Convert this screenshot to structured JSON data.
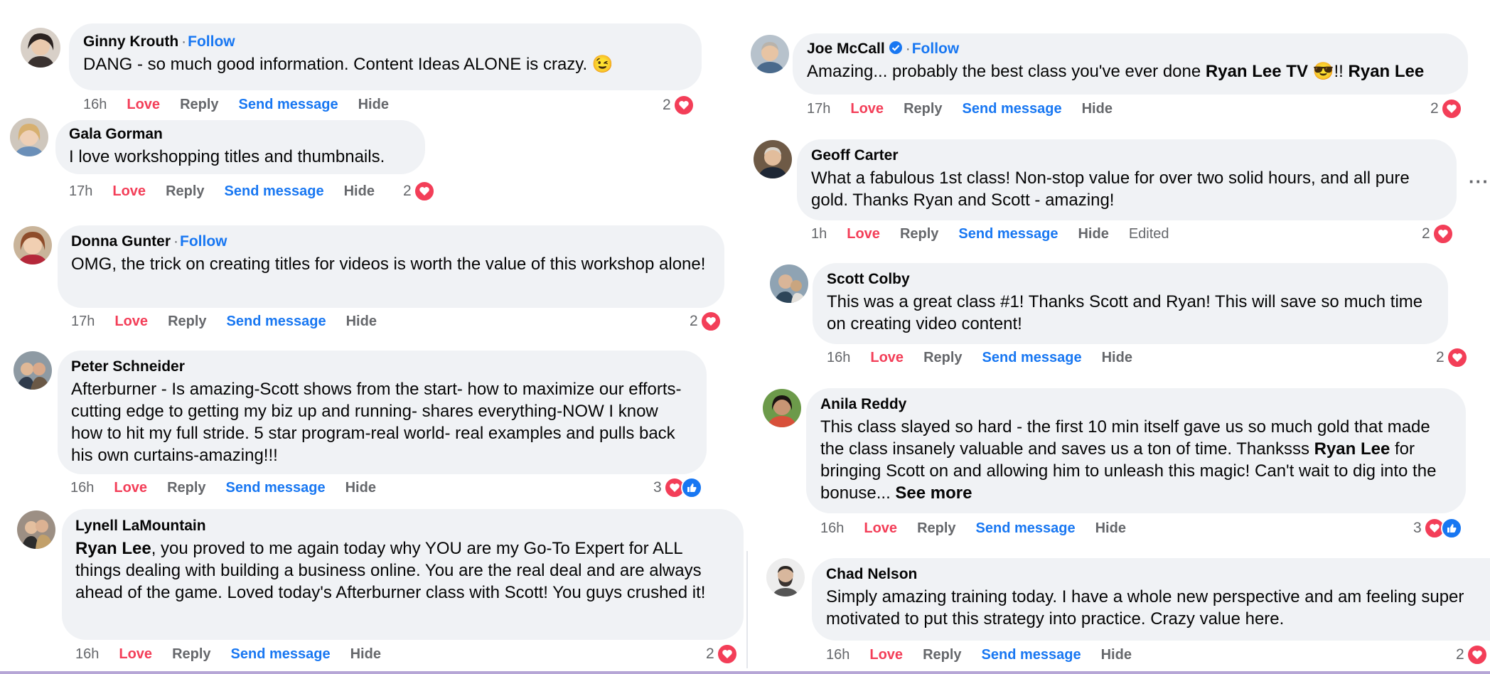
{
  "left_comments": [
    {
      "name": "Ginny Krouth",
      "follow": "Follow",
      "text": "DANG - so much good information. Content Ideas ALONE is crazy. 😉",
      "time": "16h",
      "love": "Love",
      "reply": "Reply",
      "send": "Send message",
      "hide": "Hide",
      "count": "2"
    },
    {
      "name": "Gala Gorman",
      "text": "I love workshopping titles and thumbnails.",
      "time": "17h",
      "love": "Love",
      "reply": "Reply",
      "send": "Send message",
      "hide": "Hide",
      "count": "2"
    },
    {
      "name": "Donna Gunter",
      "follow": "Follow",
      "text": "OMG, the trick on creating titles for videos is worth the value of this workshop alone!",
      "time": "17h",
      "love": "Love",
      "reply": "Reply",
      "send": "Send message",
      "hide": "Hide",
      "count": "2"
    },
    {
      "name": "Peter Schneider",
      "text": "Afterburner - Is amazing-Scott shows from the start- how to maximize our efforts- cutting edge to getting my biz up and running- shares everything-NOW I know how to hit my full stride. 5 star program-real world- real examples and pulls back his own curtains-amazing!!!",
      "time": "16h",
      "love": "Love",
      "reply": "Reply",
      "send": "Send message",
      "hide": "Hide",
      "count": "3"
    },
    {
      "name": "Lynell LaMountain",
      "mention": "Ryan Lee",
      "text": ", you proved to me again today why YOU are my Go-To Expert for ALL things dealing with building a business online. You are the real deal and are always ahead of the game. Loved today's Afterburner class with Scott! You guys crushed it!",
      "time": "16h",
      "love": "Love",
      "reply": "Reply",
      "send": "Send message",
      "hide": "Hide",
      "count": "2"
    }
  ],
  "right_comments": [
    {
      "name": "Joe McCall",
      "follow": "Follow",
      "text_pre": "Amazing... probably the best class you've ever done ",
      "mention1": "Ryan Lee TV",
      "emoji": " 😎!! ",
      "mention2": "Ryan Lee",
      "time": "17h",
      "love": "Love",
      "reply": "Reply",
      "send": "Send message",
      "hide": "Hide",
      "count": "2"
    },
    {
      "name": "Geoff Carter",
      "text": "What a fabulous 1st class! Non-stop value for over two solid hours, and all pure gold. Thanks Ryan and Scott - amazing!",
      "time": "1h",
      "love": "Love",
      "reply": "Reply",
      "send": "Send message",
      "hide": "Hide",
      "edited": "Edited",
      "count": "2"
    },
    {
      "name": "Scott Colby",
      "text": "This was a great class #1! Thanks Scott and Ryan! This will save so much time on creating video content!",
      "time": "16h",
      "love": "Love",
      "reply": "Reply",
      "send": "Send message",
      "hide": "Hide",
      "count": "2"
    },
    {
      "name": "Anila Reddy",
      "text_pre": "This class slayed so hard - the first 10 min itself gave us so much gold that made the class insanely valuable and saves us a ton of time. Thanksss ",
      "mention": "Ryan Lee",
      "text_post": " for bringing Scott on and allowing him to unleash this magic! Can't wait to dig into the bonuse... ",
      "see_more": "See more",
      "time": "16h",
      "love": "Love",
      "reply": "Reply",
      "send": "Send message",
      "hide": "Hide",
      "count": "3"
    },
    {
      "name": "Chad Nelson",
      "text": "Simply amazing training today. I have a whole new perspective and am feeling super motivated to put this strategy into practice. Crazy value here.",
      "time": "16h",
      "love": "Love",
      "reply": "Reply",
      "send": "Send message",
      "hide": "Hide",
      "count": "2"
    }
  ],
  "colors": {
    "love": "#f33e58",
    "link": "#1877f2",
    "bubble": "#f0f2f5",
    "meta": "#65676b"
  },
  "icons": [
    "heart-reaction-icon",
    "like-reaction-icon",
    "verified-badge-icon",
    "more-options-icon"
  ]
}
